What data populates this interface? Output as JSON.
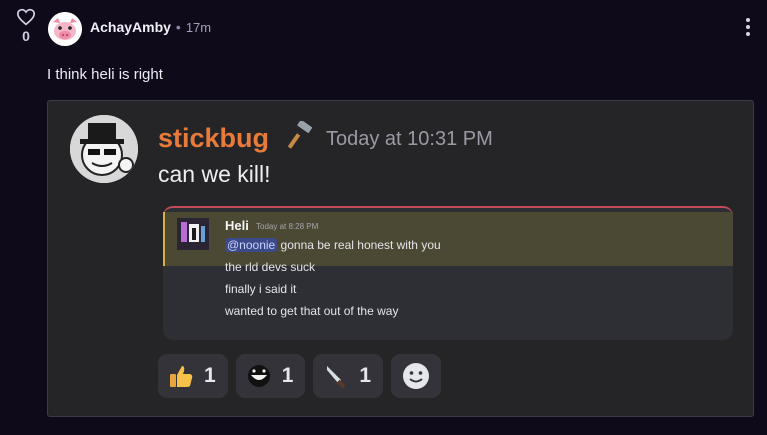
{
  "post": {
    "vote_count": "0",
    "author": "AchayAmby",
    "separator": "•",
    "time": "17m",
    "comment": "I think heli is right"
  },
  "discord": {
    "author": "stickbug",
    "timestamp": "Today at 10:31 PM",
    "message": "can we kill!",
    "reply": {
      "author": "Heli",
      "timestamp": "Today at 8:28 PM",
      "mention": "@noonie",
      "line1_rest": " gonna be real honest with you",
      "lines": [
        "the rld devs suck",
        "finally i said it",
        "wanted to get that out of the way"
      ]
    },
    "reactions": [
      {
        "icon": "thumbs-up-icon",
        "count": "1"
      },
      {
        "icon": "grinning-face-icon",
        "count": "1"
      },
      {
        "icon": "knife-icon",
        "count": "1"
      }
    ]
  },
  "colors": {
    "background": "#0e0a1a",
    "username": "#e87a3a",
    "embed_bg": "#252528",
    "mention_bg": "#3d4a8a",
    "highlight_bg": "#4b4833"
  }
}
